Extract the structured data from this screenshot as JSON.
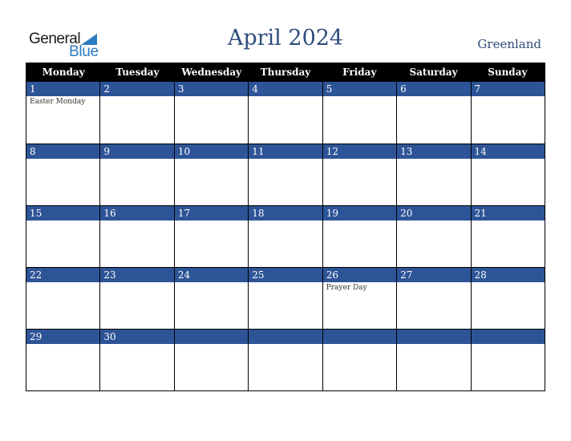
{
  "logo": {
    "general": "General",
    "blue": "Blue"
  },
  "title": "April 2024",
  "country": "Greenland",
  "weekdays": [
    "Monday",
    "Tuesday",
    "Wednesday",
    "Thursday",
    "Friday",
    "Saturday",
    "Sunday"
  ],
  "weeks": [
    [
      {
        "day": "1",
        "event": "Easter Monday"
      },
      {
        "day": "2",
        "event": ""
      },
      {
        "day": "3",
        "event": ""
      },
      {
        "day": "4",
        "event": ""
      },
      {
        "day": "5",
        "event": ""
      },
      {
        "day": "6",
        "event": ""
      },
      {
        "day": "7",
        "event": ""
      }
    ],
    [
      {
        "day": "8",
        "event": ""
      },
      {
        "day": "9",
        "event": ""
      },
      {
        "day": "10",
        "event": ""
      },
      {
        "day": "11",
        "event": ""
      },
      {
        "day": "12",
        "event": ""
      },
      {
        "day": "13",
        "event": ""
      },
      {
        "day": "14",
        "event": ""
      }
    ],
    [
      {
        "day": "15",
        "event": ""
      },
      {
        "day": "16",
        "event": ""
      },
      {
        "day": "17",
        "event": ""
      },
      {
        "day": "18",
        "event": ""
      },
      {
        "day": "19",
        "event": ""
      },
      {
        "day": "20",
        "event": ""
      },
      {
        "day": "21",
        "event": ""
      }
    ],
    [
      {
        "day": "22",
        "event": ""
      },
      {
        "day": "23",
        "event": ""
      },
      {
        "day": "24",
        "event": ""
      },
      {
        "day": "25",
        "event": ""
      },
      {
        "day": "26",
        "event": "Prayer Day"
      },
      {
        "day": "27",
        "event": ""
      },
      {
        "day": "28",
        "event": ""
      }
    ],
    [
      {
        "day": "29",
        "event": ""
      },
      {
        "day": "30",
        "event": ""
      },
      {
        "day": "",
        "event": ""
      },
      {
        "day": "",
        "event": ""
      },
      {
        "day": "",
        "event": ""
      },
      {
        "day": "",
        "event": ""
      },
      {
        "day": "",
        "event": ""
      }
    ]
  ],
  "colors": {
    "band": "#2d5496",
    "title": "#2e4d7b",
    "header": "#000000",
    "logo_blue": "#2a7bc0"
  }
}
